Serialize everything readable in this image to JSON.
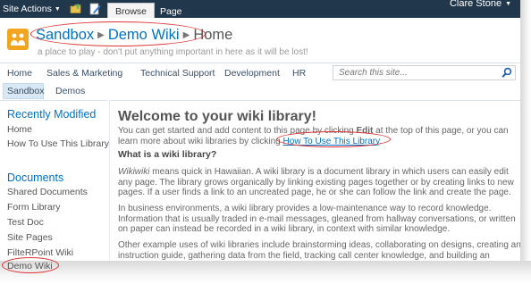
{
  "ribbon": {
    "site_actions": "Site Actions",
    "tabs": [
      {
        "label": "Browse"
      },
      {
        "label": "Page"
      }
    ],
    "user": "Clare Stone"
  },
  "header": {
    "crumbs": [
      "Sandbox",
      "Demo Wiki",
      "Home"
    ],
    "description": "a place to play - don't put anything important in here as it will be lost!"
  },
  "topnav": {
    "items": [
      "Home",
      "Sales & Marketing",
      "Technical Support",
      "Development",
      "HR"
    ],
    "search_placeholder": "Search this site..."
  },
  "subnav": {
    "items": [
      "Sandbox",
      "Demos"
    ]
  },
  "leftnav": {
    "recent_heading": "Recently Modified",
    "recent_items": [
      "Home",
      "How To Use This Library"
    ],
    "documents_heading": "Documents",
    "document_items": [
      "Shared Documents",
      "Form Library",
      "Test Doc",
      "Site Pages",
      "FilteRPoint Wiki",
      "Demo Wiki"
    ]
  },
  "content": {
    "title": "Welcome to your wiki library!",
    "intro_line1_a": "You can get started and add content to this page by clicking ",
    "intro_edit": "Edit",
    "intro_line1_b": " at the top of this page, or you can",
    "intro_line2_a": "learn more about wiki libraries by clicking ",
    "intro_link": "How To Use This Library",
    "intro_line2_b": ".",
    "what_heading": "What is a wiki library?",
    "para1_em": "Wikiwiki",
    "para1": " means quick in Hawaiian. A wiki library is a document library in which users can easily edit any page. The library grows organically by linking existing pages together or by creating links to new pages. If a user finds a link to an uncreated page, he or she can follow the link and create the page.",
    "para2": "In business environments, a wiki library provides a low-maintenance way to record knowledge. Information that is usually traded in e-mail messages, gleaned from hallway conversations, or written on paper can instead be recorded in a wiki library, in context with similar knowledge.",
    "para3": "Other example uses of wiki libraries include brainstorming ideas, collaborating on designs, creating an instruction guide, gathering data from the field, tracking call center knowledge, and building an encyclopedia of knowledge."
  },
  "icons": {
    "site_logo": "site-logo-icon",
    "folder": "folder-up-icon",
    "edit": "edit-page-icon",
    "search": "search-icon"
  },
  "colors": {
    "ribbon": "#21374c",
    "link": "#0072c6",
    "callout": "#dd3333",
    "site_icon": "#f2a51f"
  }
}
